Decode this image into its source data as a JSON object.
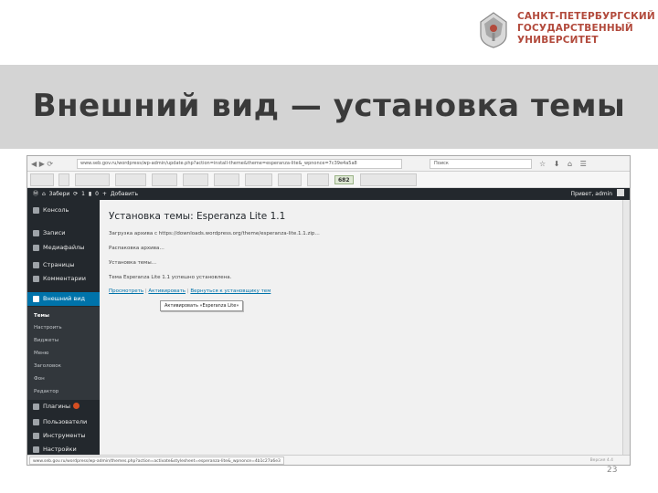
{
  "university": {
    "line1": "САНКТ-ПЕТЕРБУРГСКИЙ",
    "line2": "ГОСУДАРСТВЕННЫЙ",
    "line3": "УНИВЕРСИТЕТ"
  },
  "slide": {
    "title": "Внешний вид — установка темы",
    "page_number": "23"
  },
  "browser": {
    "url": "www.seb.gov.ru/wordpress/wp-admin/update.php?action=install-theme&theme=esperanza-lite&_wpnonce=7c39e4a5a8",
    "search_placeholder": "Поиск"
  },
  "seo_toolbar": {
    "badge": "682"
  },
  "admin_bar": {
    "site_name": "Забери",
    "updates_count": "1",
    "comments_count": "0",
    "add_new": "Добавить",
    "greeting": "Привет, admin"
  },
  "sidebar": {
    "items": [
      {
        "label": "Консоль",
        "icon": "dashboard-icon"
      },
      {
        "label": "Записи",
        "icon": "pin-icon"
      },
      {
        "label": "Медиафайлы",
        "icon": "media-icon"
      },
      {
        "label": "Страницы",
        "icon": "page-icon"
      },
      {
        "label": "Комментарии",
        "icon": "comment-icon"
      },
      {
        "label": "Внешний вид",
        "icon": "brush-icon"
      }
    ],
    "submenu": [
      "Темы",
      "Настроить",
      "Виджеты",
      "Меню",
      "Заголовок",
      "Фон",
      "Редактор"
    ],
    "bottom_items": [
      {
        "label": "Плагины",
        "icon": "plugin-icon"
      },
      {
        "label": "Пользователи",
        "icon": "users-icon"
      },
      {
        "label": "Инструменты",
        "icon": "wrench-icon"
      },
      {
        "label": "Настройки",
        "icon": "settings-icon"
      }
    ]
  },
  "main": {
    "heading": "Установка темы: Esperanza Lite 1.1",
    "lines": [
      "Загрузка архива с https://downloads.wordpress.org/theme/esperanza-lite.1.1.zip…",
      "Распаковка архива…",
      "Установка темы…",
      "Тема Esperanza Lite 1.1 успешно установлена."
    ],
    "link_preview": "Просмотреть",
    "link_activate": "Активировать",
    "link_return": "Вернуться к установщику тем",
    "separator": "|",
    "tooltip": "Активировать «Esperanza Lite»"
  },
  "status_bar": {
    "url": "www.seb.gov.ru/wordpress/wp-admin/themes.php?action=activate&stylesheet=esperanza-lite&_wpnonce=4b1c27a6e3",
    "version": "Версия 4.4"
  },
  "colors": {
    "accent": "#0073aa",
    "admin_dark": "#23282d",
    "brand": "#b24a3c"
  }
}
